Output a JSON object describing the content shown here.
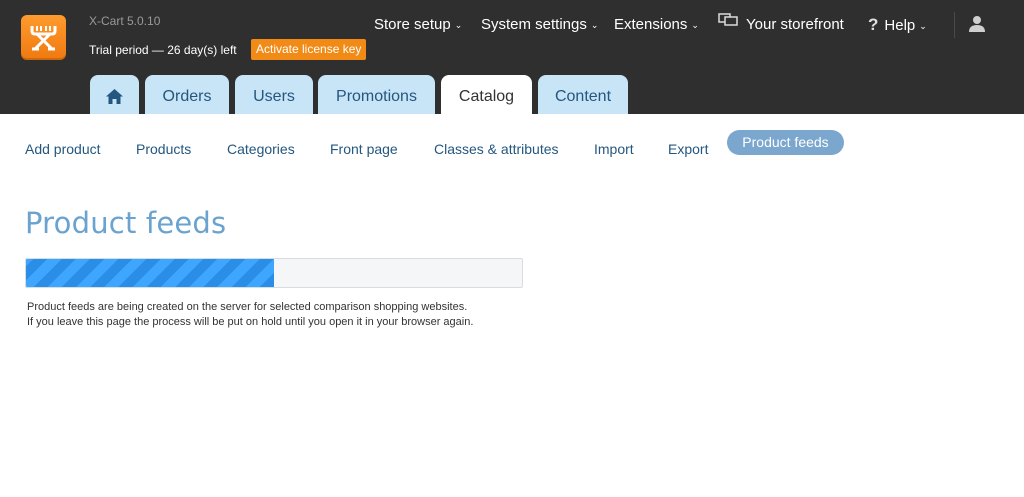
{
  "header": {
    "version": "X-Cart 5.0.10",
    "trial_text": "Trial period — 26 day(s) left",
    "activate_label": "Activate license key",
    "nav": {
      "store_setup": "Store setup",
      "system_settings": "System settings",
      "extensions": "Extensions",
      "storefront": "Your storefront",
      "help": "Help",
      "caret": "⌄",
      "help_glyph": "?"
    }
  },
  "tabs": {
    "orders": "Orders",
    "users": "Users",
    "promotions": "Promotions",
    "catalog": "Catalog",
    "content": "Content",
    "active": "Catalog"
  },
  "subnav": {
    "add_product": "Add product",
    "products": "Products",
    "categories": "Categories",
    "front_page": "Front page",
    "classes": "Classes & attributes",
    "import": "Import",
    "export": "Export",
    "product_feeds": "Product feeds"
  },
  "main": {
    "title": "Product feeds",
    "progress_fraction": 0.5,
    "note_line1": "Product feeds are being created on the server for selected comparison shopping websites.",
    "note_line2": "If you leave this page the process will be put on hold until you open it in your browser again."
  },
  "colors": {
    "header_bg": "#2f2f2f",
    "accent_orange": "#f28a16",
    "tab_bg": "#c8e4f7",
    "tab_text": "#24577f",
    "pill_bg": "#7ba6cd",
    "title": "#6aa3cf",
    "progress_a": "#2b8ee6",
    "progress_b": "#3fa6ff"
  },
  "icons": {
    "logo": "x-cart-logo-icon",
    "storefront": "monitor-icon",
    "help": "question-icon",
    "user": "user-icon",
    "home": "home-icon"
  }
}
